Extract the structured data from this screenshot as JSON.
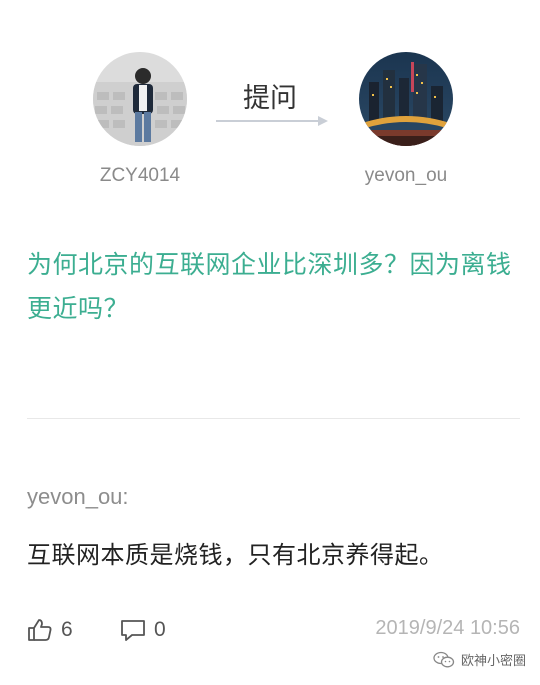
{
  "ask": {
    "asker_name": "ZCY4014",
    "answerer_name": "yevon_ou",
    "ask_label": "提问",
    "arrow_icon": "arrow-right-icon"
  },
  "question": {
    "text": "为何北京的互联网企业比深圳多？因为离钱更近吗？"
  },
  "answer": {
    "author": "yevon_ou:",
    "text": "互联网本质是烧钱，只有北京养得起。",
    "likes": "6",
    "comments": "0",
    "timestamp": "2019/9/24 10:56",
    "like_icon": "thumbs-up-icon",
    "comment_icon": "comment-icon"
  },
  "watermark": {
    "text": "欧神小密圈"
  },
  "colors": {
    "question_accent": "#3cae91",
    "muted_text": "#8a8a8a",
    "timestamp": "#b5b5b5"
  }
}
